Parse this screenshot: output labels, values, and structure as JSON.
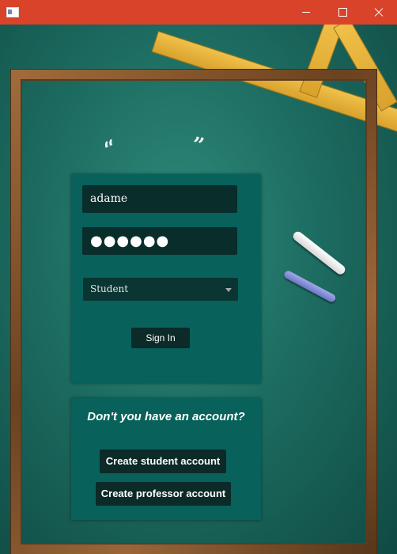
{
  "window": {
    "title": ""
  },
  "icons": {
    "app": "app-icon",
    "minimize": "minimize-icon",
    "maximize": "maximize-icon",
    "close": "close-icon"
  },
  "login": {
    "username_value": "adame",
    "password_mask": "●●●●●●",
    "role_selected": "Student",
    "signin_label": "Sign In"
  },
  "signup": {
    "question": "Don't you have an account?",
    "student_label": "Create student account",
    "professor_label": "Create professor account"
  },
  "decor": {
    "quote_left": "“",
    "quote_right": "”"
  },
  "colors": {
    "titlebar": "#d9432a",
    "panel": "#08615a",
    "field": "#092d2b",
    "button": "#0b2a28"
  }
}
